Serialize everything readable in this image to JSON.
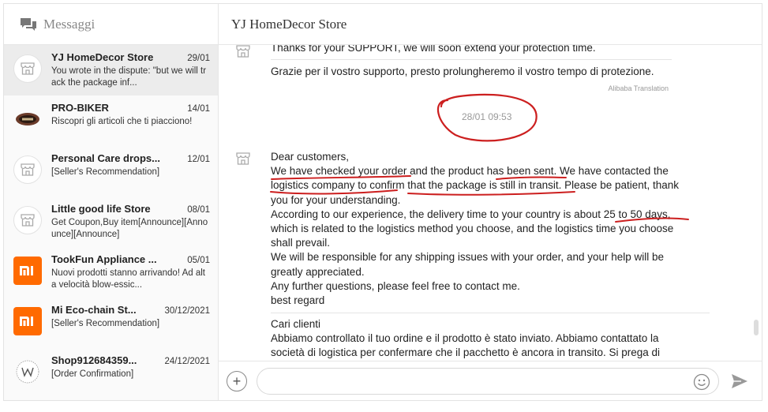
{
  "sidebar": {
    "title": "Messaggi",
    "conversations": [
      {
        "name": "YJ HomeDecor Store",
        "date": "29/01",
        "preview": "You wrote in the dispute: \"but we will track the package inf...",
        "avatar": "store-icon",
        "active": true
      },
      {
        "name": "PRO-BIKER",
        "date": "14/01",
        "preview": "Riscopri gli articoli che ti piacciono!",
        "avatar": "probiker-logo"
      },
      {
        "name": "Personal Care drops...",
        "date": "12/01",
        "preview": "[Seller's Recommendation]",
        "avatar": "store-icon"
      },
      {
        "name": "Little good life Store",
        "date": "08/01",
        "preview": "Get Coupon,Buy item[Announce][Announce][Announce]",
        "avatar": "store-icon"
      },
      {
        "name": "TookFun Appliance ...",
        "date": "05/01",
        "preview": "Nuovi prodotti stanno arrivando! Ad alta velocità blow-essic...",
        "avatar": "mi-logo"
      },
      {
        "name": "Mi Eco-chain St...",
        "date": "30/12/2021",
        "preview": "[Seller's Recommendation]",
        "avatar": "mi-logo"
      },
      {
        "name": "Shop912684359...",
        "date": "24/12/2021",
        "preview": "[Order Confirmation]",
        "avatar": "w-logo"
      }
    ]
  },
  "main": {
    "store_title": "YJ HomeDecor Store",
    "messages": {
      "prev_original": "Thanks for your SUPPORT, we will soon extend your protection time.",
      "prev_translation": "Grazie per il vostro supporto, presto prolungheremo il vostro tempo di protezione.",
      "translation_label": "Alibaba Translation",
      "timestamp": "28/01 09:53",
      "msg_lines": [
        "Dear customers,",
        "We have checked your order and the product has been sent. We have contacted the",
        "logistics company to confirm that the package is still in transit. Please be patient, thank",
        "you for your understanding.",
        "According to our experience, the delivery time to your country is about 25 to 50 days,",
        "which is related to the logistics method you choose, and the logistics time you choose",
        "shall prevail.",
        "We will be responsible for any shipping issues with your order, and your help will be",
        "greatly appreciated.",
        "Any further questions, please feel free to contact me.",
        "best regard"
      ],
      "translation_lines": [
        "Cari clienti",
        "Abbiamo controllato il tuo ordine e il prodotto è stato inviato. Abbiamo contattato la",
        "società di logistica per confermare che il pacchetto è ancora in transito. Si prega di"
      ]
    },
    "composer": {
      "add_label": "+",
      "placeholder": ""
    }
  },
  "colors": {
    "accent": "#ff6a00",
    "annotation": "#cc1f1f",
    "active_row": "#ececec"
  }
}
